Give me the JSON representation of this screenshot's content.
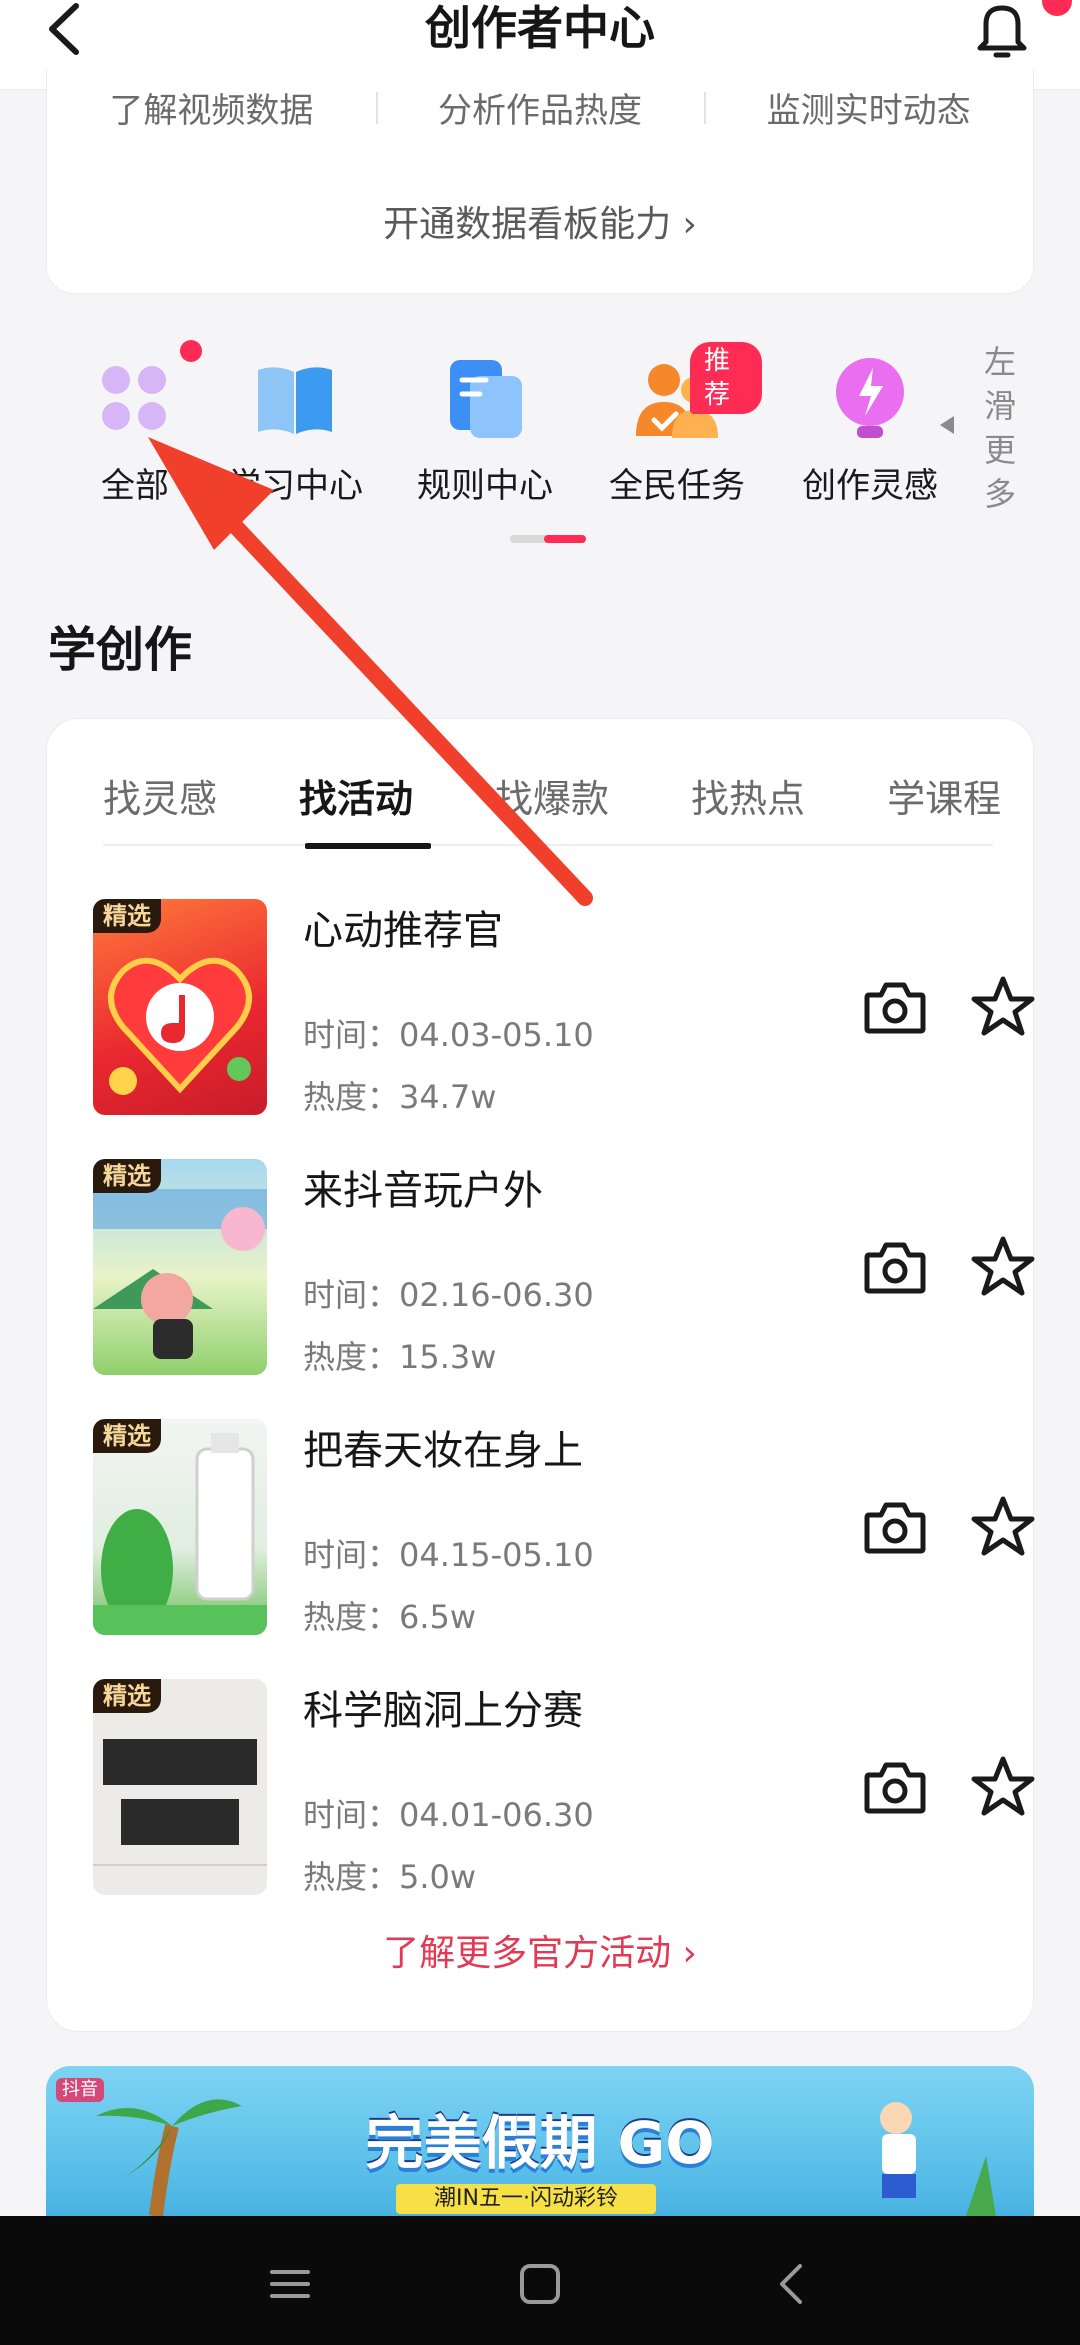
{
  "header": {
    "title": "创作者中心",
    "back_icon": "chevron-left-icon",
    "bell_icon": "bell-icon"
  },
  "data_card": {
    "metrics": [
      "了解视频数据",
      "分析作品热度",
      "监测实时动态"
    ],
    "open_link": "开通数据看板能力 ›"
  },
  "tools": {
    "items": [
      {
        "label": "全部",
        "icon": "grid-icon"
      },
      {
        "label": "学习中心",
        "icon": "book-icon"
      },
      {
        "label": "规则中心",
        "icon": "document-icon"
      },
      {
        "label": "全民任务",
        "icon": "people-icon"
      },
      {
        "label": "创作灵感",
        "icon": "bulb-icon"
      }
    ],
    "badge": "推荐",
    "slide_hint": "左滑更多"
  },
  "section": {
    "title": "学创作"
  },
  "tabs": [
    "找灵感",
    "找活动",
    "找爆款",
    "找热点",
    "学课程"
  ],
  "active_tab": "找活动",
  "activities": [
    {
      "tag": "精选",
      "name": "心动推荐官",
      "time": "时间：04.03-05.10",
      "heat": "热度：34.7w"
    },
    {
      "tag": "精选",
      "name": "来抖音玩户外",
      "time": "时间：02.16-06.30",
      "heat": "热度：15.3w"
    },
    {
      "tag": "精选",
      "name": "把春天妆在身上",
      "time": "时间：04.15-05.10",
      "heat": "热度：6.5w"
    },
    {
      "tag": "精选",
      "name": "科学脑洞上分赛",
      "time": "时间：04.01-06.30",
      "heat": "热度：5.0w"
    }
  ],
  "more_link": "了解更多官方活动 ›",
  "banner": {
    "brand": "抖音",
    "title": "完美假期 GO",
    "subtitle": "潮IN五一·闪动彩铃"
  },
  "colors": {
    "accent": "#fe2c55",
    "link": "#e03a55",
    "annotation_arrow": "#f0402c"
  }
}
